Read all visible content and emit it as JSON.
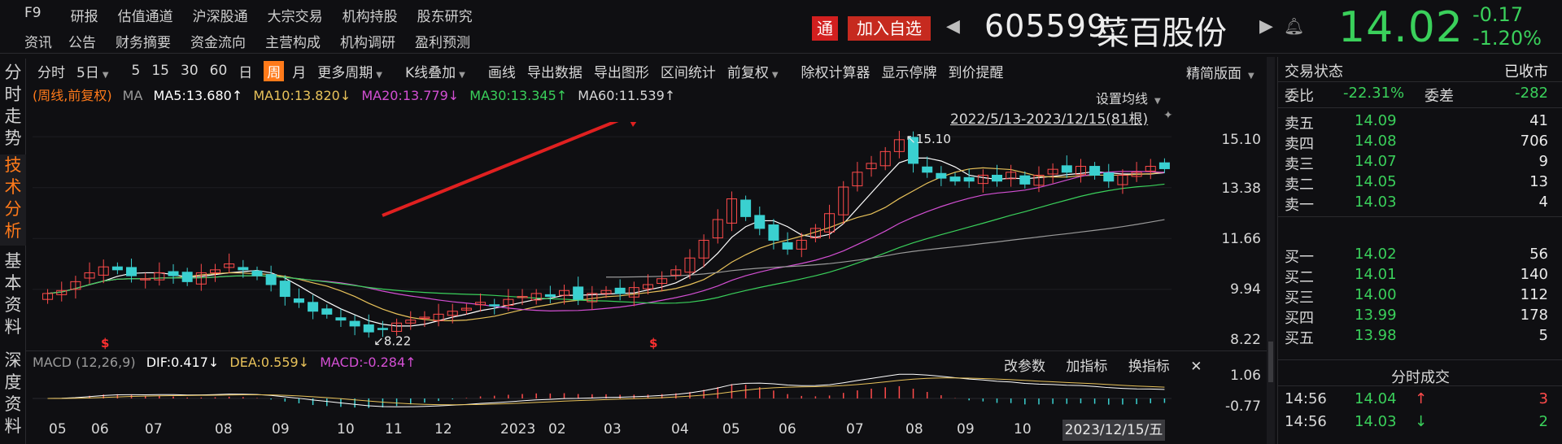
{
  "top": {
    "row1": [
      "F9",
      "研报",
      "估值通道",
      "沪深股通",
      "大宗交易",
      "机构持股",
      "股东研究"
    ],
    "row2": [
      "资讯",
      "公告",
      "财务摘要",
      "资金流向",
      "主营构成",
      "机构调研",
      "盈利预测"
    ],
    "tong_badge": "通",
    "add_watch": "加入自选",
    "code": "605599",
    "name": "菜百股份",
    "price": "14.02",
    "change": "-0.17",
    "change_pct": "-1.20%"
  },
  "side_tabs": [
    "分时走势",
    "技术分析",
    "基本资料",
    "深度资料"
  ],
  "toolbar": {
    "items": [
      "分时",
      "5日",
      "5",
      "15",
      "30",
      "60",
      "日",
      "周",
      "月",
      "更多周期",
      "K线叠加",
      "画线",
      "导出数据",
      "导出图形",
      "区间统计",
      "前复权",
      "除权计算器",
      "显示停牌",
      "到价提醒"
    ],
    "active": "周",
    "right": "精简版面"
  },
  "ma": {
    "prefix": "(周线,前复权)",
    "label": "MA",
    "ma5": "MA5:13.680↑",
    "ma10": "MA10:13.820↓",
    "ma20": "MA20:13.779↓",
    "ma30": "MA30:13.345↑",
    "ma60": "MA60:11.539↑",
    "settings": "设置均线",
    "range": "2022/5/13-2023/12/15(81根)"
  },
  "macd": {
    "title": "MACD (12,26,9)",
    "dif": "DIF:0.417↓",
    "dea": "DEA:0.559↓",
    "macd": "MACD:-0.284↑",
    "btn1": "改参数",
    "btn2": "加指标",
    "btn3": "换指标",
    "close": "✕"
  },
  "y_axis": [
    "15.10",
    "13.38",
    "11.66",
    "9.94",
    "8.22"
  ],
  "macd_axis": [
    "1.06",
    "-0.77"
  ],
  "x_axis": [
    "05",
    "06",
    "07",
    "08",
    "09",
    "10",
    "11",
    "12",
    "2023",
    "02",
    "03",
    "04",
    "05",
    "06",
    "07",
    "08",
    "09",
    "10"
  ],
  "x_last": "2023/12/15/五",
  "annotations": {
    "high": "15.10",
    "low": "8.22"
  },
  "colors": {
    "up": "#ff4b4b",
    "down": "#3ad0d0",
    "ma5": "#ffffff",
    "ma10": "#e8c25a",
    "ma20": "#d34fd3",
    "ma30": "#3ad05b",
    "ma60": "#9a9a9a",
    "arrow": "#e02020"
  },
  "right_panel": {
    "status_label": "交易状态",
    "status_value": "已收市",
    "weibi_label": "委比",
    "weibi_value": "-22.31%",
    "weicha_label": "委差",
    "weicha_value": "-282",
    "asks": [
      {
        "label": "卖五",
        "price": "14.09",
        "vol": "41"
      },
      {
        "label": "卖四",
        "price": "14.08",
        "vol": "706"
      },
      {
        "label": "卖三",
        "price": "14.07",
        "vol": "9"
      },
      {
        "label": "卖二",
        "price": "14.05",
        "vol": "13"
      },
      {
        "label": "卖一",
        "price": "14.03",
        "vol": "4"
      }
    ],
    "bids": [
      {
        "label": "买一",
        "price": "14.02",
        "vol": "56"
      },
      {
        "label": "买二",
        "price": "14.01",
        "vol": "140"
      },
      {
        "label": "买三",
        "price": "14.00",
        "vol": "112"
      },
      {
        "label": "买四",
        "price": "13.99",
        "vol": "178"
      },
      {
        "label": "买五",
        "price": "13.98",
        "vol": "5"
      }
    ],
    "trades_title": "分时成交",
    "trades": [
      {
        "time": "14:56",
        "price": "14.04",
        "dir": "↑",
        "vol": "3"
      },
      {
        "time": "14:56",
        "price": "14.03",
        "dir": "↓",
        "vol": "2"
      }
    ]
  },
  "chart_data": {
    "type": "candlestick",
    "period": "weekly",
    "ylim": [
      8.22,
      15.1
    ],
    "closes": [
      9.8,
      9.9,
      10.2,
      10.5,
      10.7,
      10.6,
      10.4,
      10.3,
      10.5,
      10.4,
      10.2,
      10.5,
      10.6,
      10.8,
      10.6,
      10.4,
      10.1,
      9.7,
      9.5,
      9.2,
      9.1,
      8.9,
      8.7,
      8.5,
      8.6,
      8.8,
      8.9,
      9.0,
      9.1,
      9.2,
      9.3,
      9.5,
      9.4,
      9.6,
      9.7,
      9.8,
      9.7,
      9.9,
      9.6,
      9.8,
      9.9,
      9.8,
      10.0,
      10.1,
      10.3,
      10.6,
      11.0,
      11.6,
      12.3,
      13.0,
      12.4,
      12.0,
      11.6,
      11.3,
      11.6,
      12.0,
      12.5,
      13.4,
      13.9,
      14.2,
      14.6,
      15.0,
      14.2,
      13.9,
      13.7,
      13.6,
      13.6,
      13.8,
      13.6,
      13.9,
      13.5,
      13.8,
      14.0,
      13.9,
      14.1,
      13.8,
      13.6,
      13.8,
      13.9,
      14.1,
      14.02
    ],
    "ma60_start_index": 40
  }
}
